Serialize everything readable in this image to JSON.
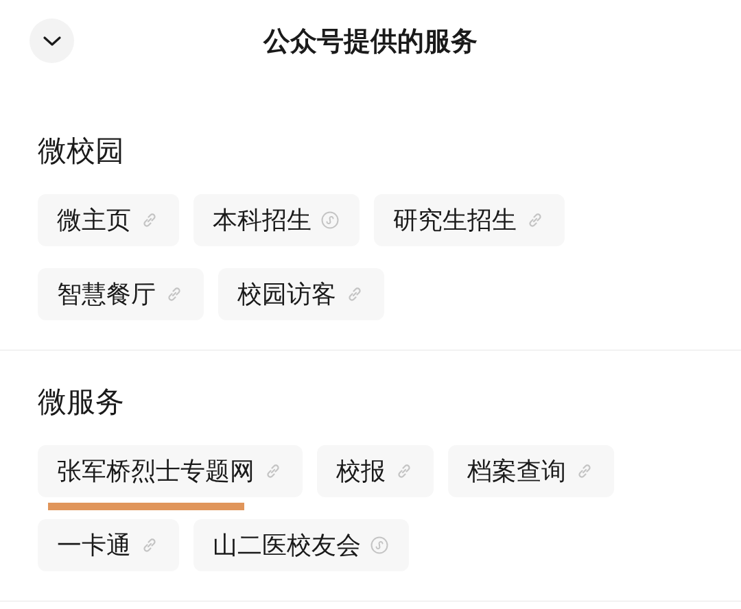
{
  "header": {
    "title": "公众号提供的服务"
  },
  "sections": [
    {
      "title": "微校园",
      "items": [
        {
          "label": "微主页",
          "kind": "link",
          "underlined": false
        },
        {
          "label": "本科招生",
          "kind": "miniprogram",
          "underlined": false
        },
        {
          "label": "研究生招生",
          "kind": "link",
          "underlined": false
        },
        {
          "label": "智慧餐厅",
          "kind": "link",
          "underlined": false
        },
        {
          "label": "校园访客",
          "kind": "link",
          "underlined": false
        }
      ]
    },
    {
      "title": "微服务",
      "items": [
        {
          "label": "张军桥烈士专题网",
          "kind": "link",
          "underlined": true
        },
        {
          "label": "校报",
          "kind": "link",
          "underlined": false
        },
        {
          "label": "档案查询",
          "kind": "link",
          "underlined": false
        },
        {
          "label": "一卡通",
          "kind": "link",
          "underlined": false
        },
        {
          "label": "山二医校友会",
          "kind": "miniprogram",
          "underlined": false
        }
      ]
    }
  ]
}
